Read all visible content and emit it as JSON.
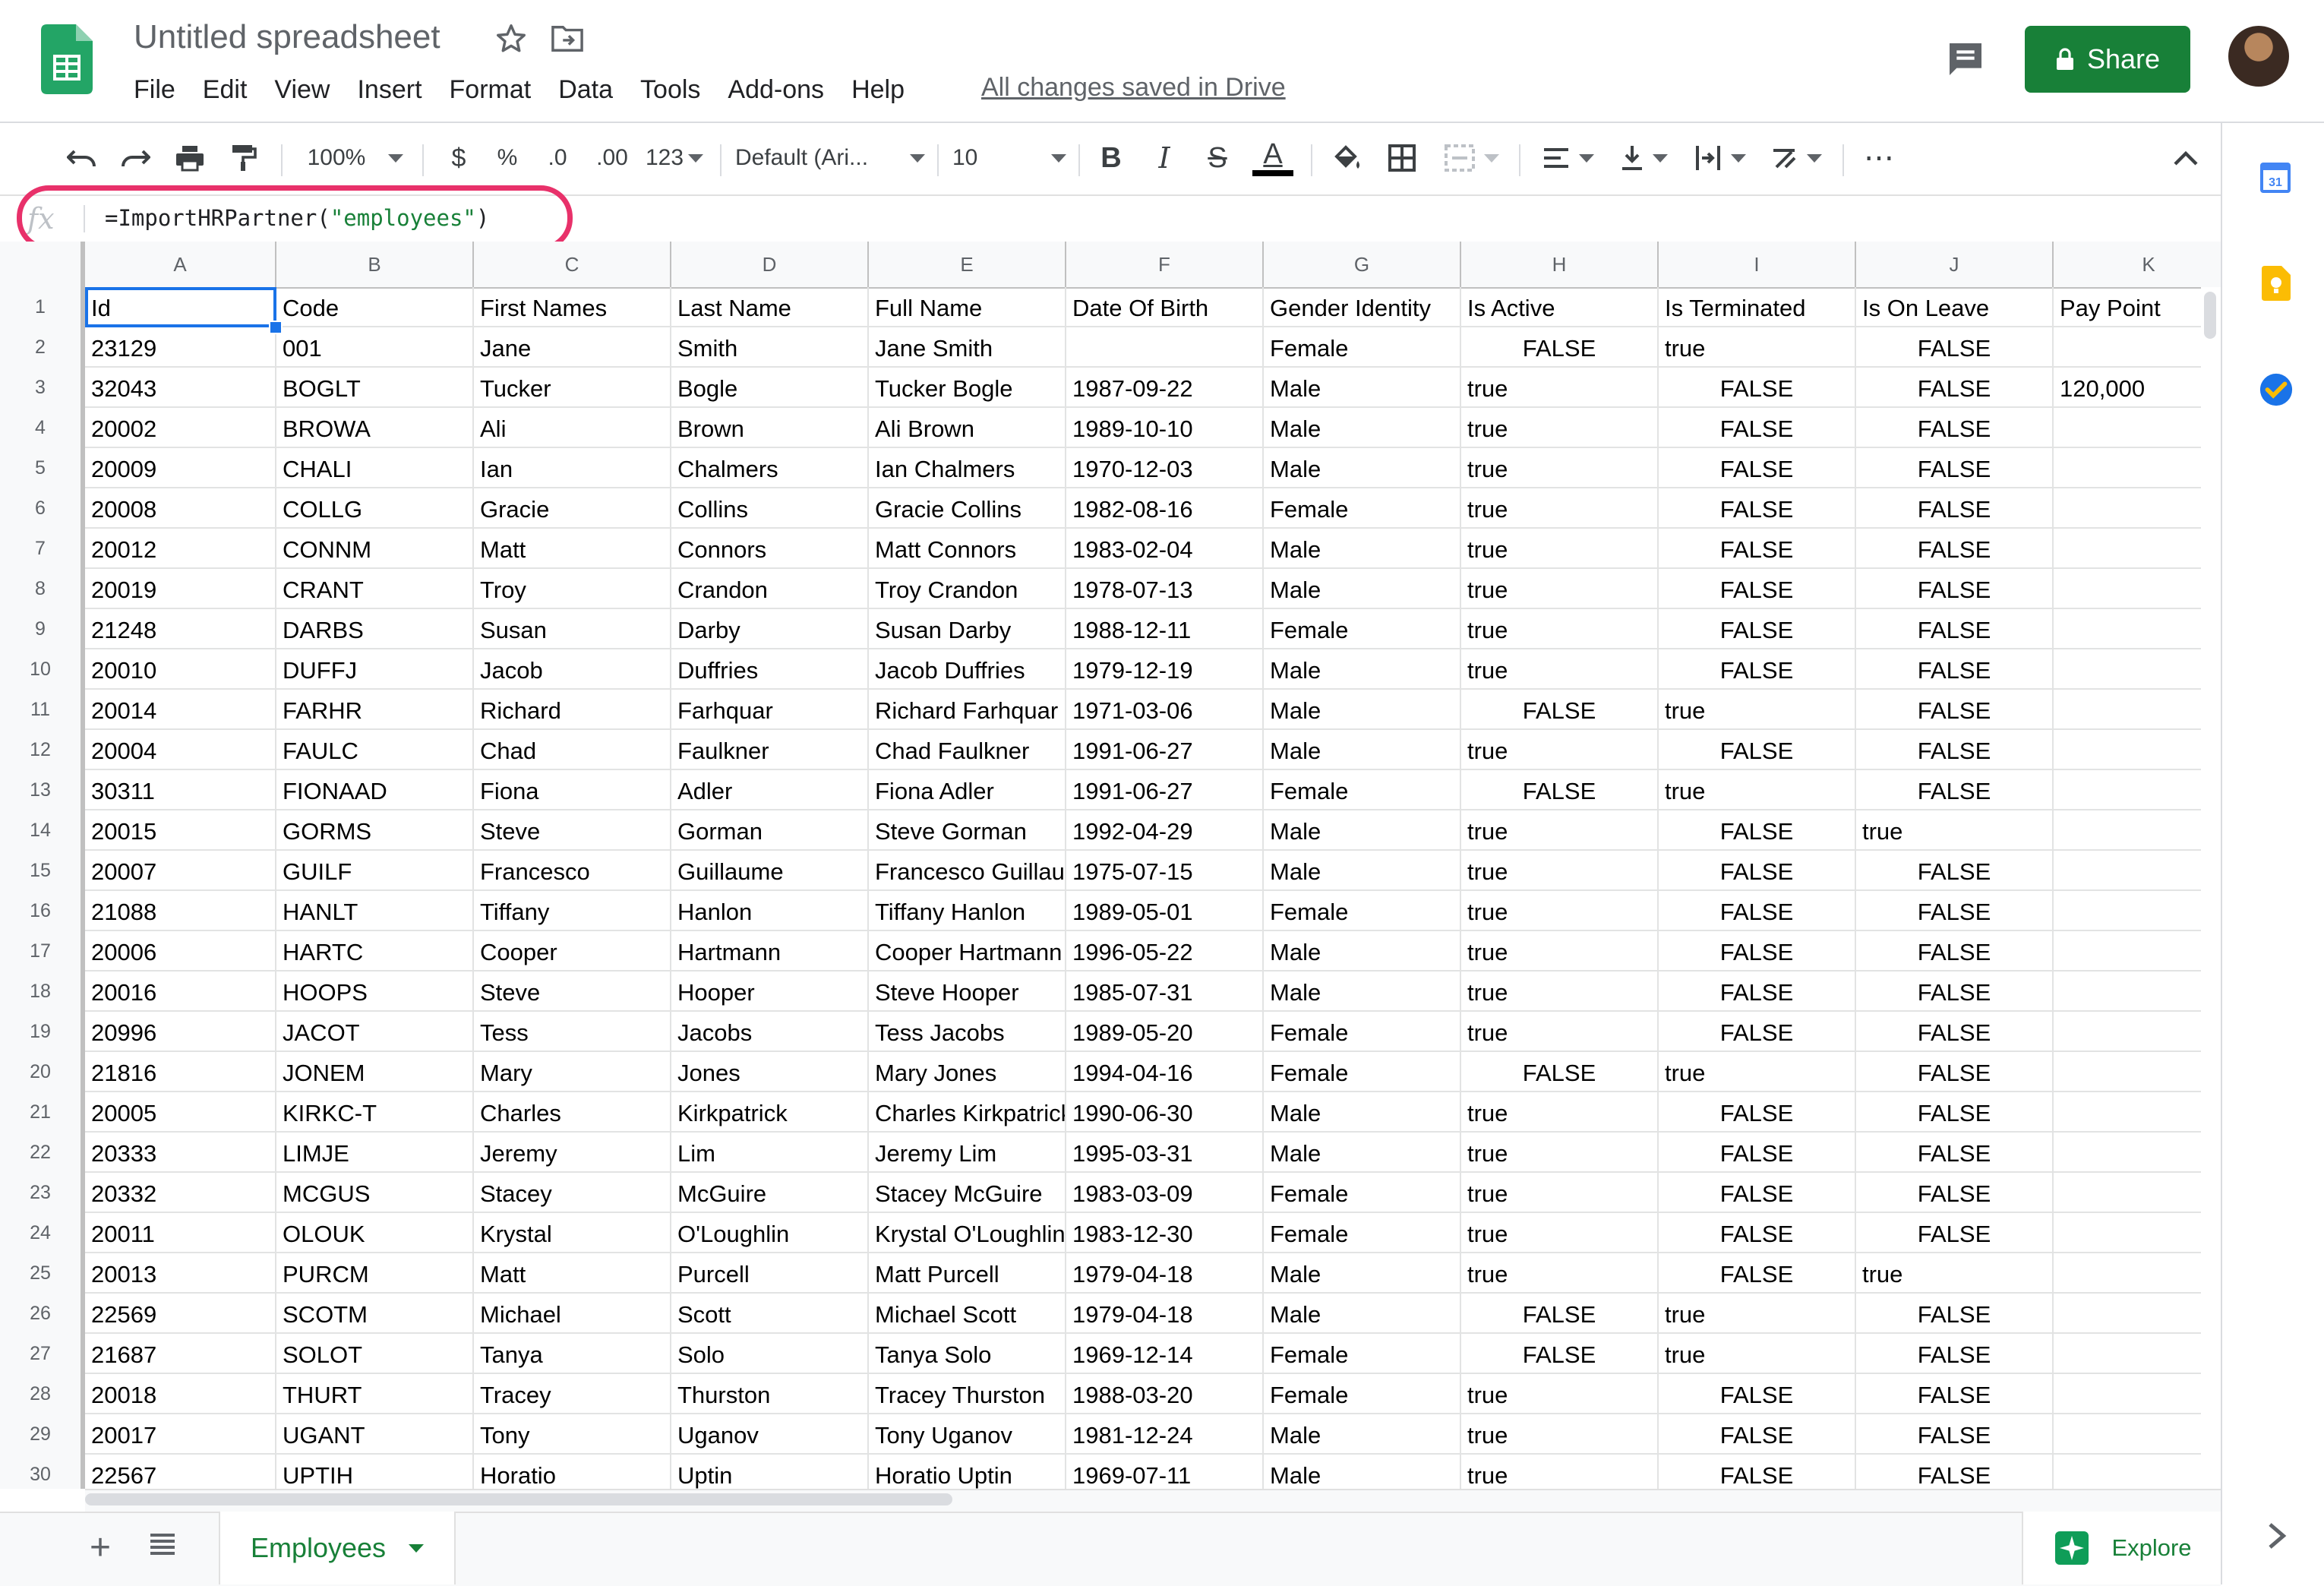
{
  "doc": {
    "title": "Untitled spreadsheet",
    "saved_status": "All changes saved in Drive"
  },
  "menu": [
    "File",
    "Edit",
    "View",
    "Insert",
    "Format",
    "Data",
    "Tools",
    "Add-ons",
    "Help"
  ],
  "share": {
    "label": "Share"
  },
  "toolbar": {
    "zoom": "100%",
    "currency": "$",
    "percent": "%",
    "dec_decrease": ".0",
    "dec_increase": ".00",
    "more_formats": "123",
    "font": "Default (Ari...",
    "font_size": "10",
    "bold": "B",
    "italic": "I",
    "strike": "S",
    "text_color": "A",
    "more": "⋯"
  },
  "formula_bar": {
    "fx": "fx",
    "prefix": "=ImportHRPartner(",
    "string": "\"employees\"",
    "suffix": ")"
  },
  "colors": {
    "share_green": "#188038",
    "highlight_ring": "#e8316a",
    "selection_blue": "#1a73e8"
  },
  "grid": {
    "columns": [
      "A",
      "B",
      "C",
      "D",
      "E",
      "F",
      "G",
      "H",
      "I",
      "J",
      "K"
    ],
    "rows": [
      [
        "Id",
        "Code",
        "First Names",
        "Last Name",
        "Full Name",
        "Date Of Birth",
        "Gender Identity",
        "Is Active",
        "Is Terminated",
        "Is On Leave",
        "Pay Point"
      ],
      [
        "23129",
        "001",
        "Jane",
        "Smith",
        "Jane Smith",
        "",
        "Female",
        "FALSE",
        "true",
        "FALSE",
        ""
      ],
      [
        "32043",
        "BOGLT",
        "Tucker",
        "Bogle",
        "Tucker Bogle",
        "1987-09-22",
        "Male",
        "true",
        "FALSE",
        "FALSE",
        "120,000"
      ],
      [
        "20002",
        "BROWA",
        "Ali",
        "Brown",
        "Ali Brown",
        "1989-10-10",
        "Male",
        "true",
        "FALSE",
        "FALSE",
        ""
      ],
      [
        "20009",
        "CHALI",
        "Ian",
        "Chalmers",
        "Ian Chalmers",
        "1970-12-03",
        "Male",
        "true",
        "FALSE",
        "FALSE",
        ""
      ],
      [
        "20008",
        "COLLG",
        "Gracie",
        "Collins",
        "Gracie Collins",
        "1982-08-16",
        "Female",
        "true",
        "FALSE",
        "FALSE",
        ""
      ],
      [
        "20012",
        "CONNM",
        "Matt",
        "Connors",
        "Matt Connors",
        "1983-02-04",
        "Male",
        "true",
        "FALSE",
        "FALSE",
        ""
      ],
      [
        "20019",
        "CRANT",
        "Troy",
        "Crandon",
        "Troy Crandon",
        "1978-07-13",
        "Male",
        "true",
        "FALSE",
        "FALSE",
        ""
      ],
      [
        "21248",
        "DARBS",
        "Susan",
        "Darby",
        "Susan Darby",
        "1988-12-11",
        "Female",
        "true",
        "FALSE",
        "FALSE",
        ""
      ],
      [
        "20010",
        "DUFFJ",
        "Jacob",
        "Duffries",
        "Jacob Duffries",
        "1979-12-19",
        "Male",
        "true",
        "FALSE",
        "FALSE",
        ""
      ],
      [
        "20014",
        "FARHR",
        "Richard",
        "Farhquar",
        "Richard Farhquar",
        "1971-03-06",
        "Male",
        "FALSE",
        "true",
        "FALSE",
        ""
      ],
      [
        "20004",
        "FAULC",
        "Chad",
        "Faulkner",
        "Chad Faulkner",
        "1991-06-27",
        "Male",
        "true",
        "FALSE",
        "FALSE",
        ""
      ],
      [
        "30311",
        "FIONAAD",
        "Fiona",
        "Adler",
        "Fiona Adler",
        "1991-06-27",
        "Female",
        "FALSE",
        "true",
        "FALSE",
        ""
      ],
      [
        "20015",
        "GORMS",
        "Steve",
        "Gorman",
        "Steve Gorman",
        "1992-04-29",
        "Male",
        "true",
        "FALSE",
        "true",
        ""
      ],
      [
        "20007",
        "GUILF",
        "Francesco",
        "Guillaume",
        "Francesco Guillaume",
        "1975-07-15",
        "Male",
        "true",
        "FALSE",
        "FALSE",
        ""
      ],
      [
        "21088",
        "HANLT",
        "Tiffany",
        "Hanlon",
        "Tiffany Hanlon",
        "1989-05-01",
        "Female",
        "true",
        "FALSE",
        "FALSE",
        ""
      ],
      [
        "20006",
        "HARTC",
        "Cooper",
        "Hartmann",
        "Cooper Hartmann",
        "1996-05-22",
        "Male",
        "true",
        "FALSE",
        "FALSE",
        ""
      ],
      [
        "20016",
        "HOOPS",
        "Steve",
        "Hooper",
        "Steve Hooper",
        "1985-07-31",
        "Male",
        "true",
        "FALSE",
        "FALSE",
        ""
      ],
      [
        "20996",
        "JACOT",
        "Tess",
        "Jacobs",
        "Tess Jacobs",
        "1989-05-20",
        "Female",
        "true",
        "FALSE",
        "FALSE",
        ""
      ],
      [
        "21816",
        "JONEM",
        "Mary",
        "Jones",
        "Mary Jones",
        "1994-04-16",
        "Female",
        "FALSE",
        "true",
        "FALSE",
        ""
      ],
      [
        "20005",
        "KIRKC-T",
        "Charles",
        "Kirkpatrick",
        "Charles Kirkpatrick",
        "1990-06-30",
        "Male",
        "true",
        "FALSE",
        "FALSE",
        ""
      ],
      [
        "20333",
        "LIMJE",
        "Jeremy",
        "Lim",
        "Jeremy Lim",
        "1995-03-31",
        "Male",
        "true",
        "FALSE",
        "FALSE",
        ""
      ],
      [
        "20332",
        "MCGUS",
        "Stacey",
        "McGuire",
        "Stacey McGuire",
        "1983-03-09",
        "Female",
        "true",
        "FALSE",
        "FALSE",
        ""
      ],
      [
        "20011",
        "OLOUK",
        "Krystal",
        "O'Loughlin",
        "Krystal O'Loughlin",
        "1983-12-30",
        "Female",
        "true",
        "FALSE",
        "FALSE",
        ""
      ],
      [
        "20013",
        "PURCM",
        "Matt",
        "Purcell",
        "Matt Purcell",
        "1979-04-18",
        "Male",
        "true",
        "FALSE",
        "true",
        ""
      ],
      [
        "22569",
        "SCOTM",
        "Michael",
        "Scott",
        "Michael Scott",
        "1979-04-18",
        "Male",
        "FALSE",
        "true",
        "FALSE",
        ""
      ],
      [
        "21687",
        "SOLOT",
        "Tanya",
        "Solo",
        "Tanya Solo",
        "1969-12-14",
        "Female",
        "FALSE",
        "true",
        "FALSE",
        ""
      ],
      [
        "20018",
        "THURT",
        "Tracey",
        "Thurston",
        "Tracey Thurston",
        "1988-03-20",
        "Female",
        "true",
        "FALSE",
        "FALSE",
        ""
      ],
      [
        "20017",
        "UGANT",
        "Tony",
        "Uganov",
        "Tony Uganov",
        "1981-12-24",
        "Male",
        "true",
        "FALSE",
        "FALSE",
        ""
      ],
      [
        "22567",
        "UPTIH",
        "Horatio",
        "Uptin",
        "Horatio Uptin",
        "1969-07-11",
        "Male",
        "true",
        "FALSE",
        "FALSE",
        ""
      ]
    ]
  },
  "sheet_tab": {
    "label": "Employees"
  },
  "explore": {
    "label": "Explore"
  },
  "side_panel": {
    "calendar_day": "31"
  }
}
